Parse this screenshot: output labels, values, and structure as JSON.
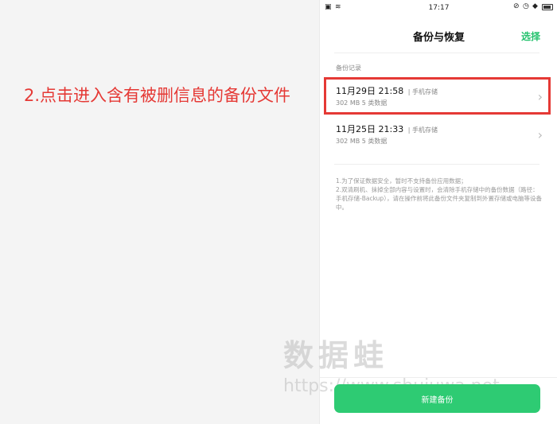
{
  "caption": "2.点击进入含有被删信息的备份文件",
  "statusbar": {
    "time": "17:17"
  },
  "header": {
    "title": "备份与恢复",
    "select_label": "选择"
  },
  "section_label": "备份记录",
  "backups": [
    {
      "date": "11月29日 21:58",
      "location": "| 手机存储",
      "meta": "302 MB  5 类数据"
    },
    {
      "date": "11月25日 21:33",
      "location": "| 手机存储",
      "meta": "302 MB  5 类数据"
    }
  ],
  "notes": [
    "1.为了保证数据安全，暂时不支持备份应用数据；",
    "2.双清刷机、抹掉全部内容与设置时，会清除手机存储中的备份数据（路径：手机存储-Backup），请在操作前将此备份文件夹复制到外置存储或电脑等设备中。"
  ],
  "watermark": {
    "text": "数据蛙",
    "url": "https://www.shujuwa.net"
  },
  "primary_button": "新建备份",
  "colors": {
    "accent": "#2ecb73",
    "highlight": "#e53935"
  }
}
